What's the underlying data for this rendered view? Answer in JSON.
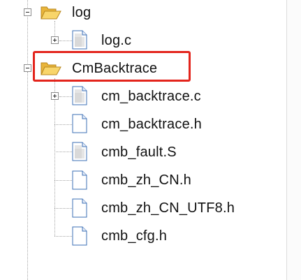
{
  "tree": {
    "nodes": [
      {
        "label": "log",
        "kind": "folder",
        "expander": "minus",
        "icon": "open-folder-icon"
      },
      {
        "label": "log.c",
        "kind": "file",
        "expander": "plus",
        "icon": "c-source-file-icon"
      },
      {
        "label": "CmBacktrace",
        "kind": "folder",
        "expander": "minus",
        "icon": "open-folder-icon",
        "highlighted": true
      },
      {
        "label": "cm_backtrace.c",
        "kind": "file",
        "expander": "plus",
        "icon": "c-source-file-icon"
      },
      {
        "label": "cm_backtrace.h",
        "kind": "file",
        "expander": "none",
        "icon": "header-file-icon"
      },
      {
        "label": "cmb_fault.S",
        "kind": "file",
        "expander": "none",
        "icon": "asm-file-icon"
      },
      {
        "label": "cmb_zh_CN.h",
        "kind": "file",
        "expander": "none",
        "icon": "header-file-icon"
      },
      {
        "label": "cmb_zh_CN_UTF8.h",
        "kind": "file",
        "expander": "none",
        "icon": "header-file-icon"
      },
      {
        "label": "cmb_cfg.h",
        "kind": "file",
        "expander": "none",
        "icon": "header-file-icon"
      }
    ],
    "highlight_color": "#e3241c",
    "folder_color": "#f3c44a"
  }
}
